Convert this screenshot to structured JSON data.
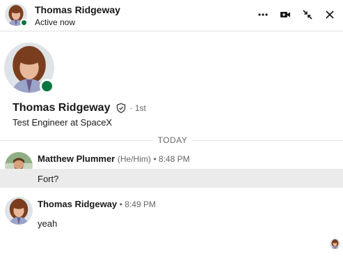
{
  "header": {
    "name": "Thomas Ridgeway",
    "status": "Active now",
    "icons": [
      "more-horizontal-icon",
      "video-call-icon",
      "minimize-icon",
      "close-icon"
    ]
  },
  "profile": {
    "name": "Thomas Ridgeway",
    "degree": "· 1st",
    "headline": "Test Engineer at SpaceX"
  },
  "divider": {
    "label": "TODAY"
  },
  "messages": [
    {
      "sender": "Matthew Plummer",
      "pronouns": "(He/Him)",
      "time": "• 8:48 PM",
      "text": "Fort?"
    },
    {
      "sender": "Thomas Ridgeway",
      "time": "• 8:49 PM",
      "text": "yeah"
    }
  ],
  "colors": {
    "presence": "#057642",
    "highlight": "#ebebeb",
    "divider": "#e0dfdc",
    "muted_text": "#666666"
  }
}
